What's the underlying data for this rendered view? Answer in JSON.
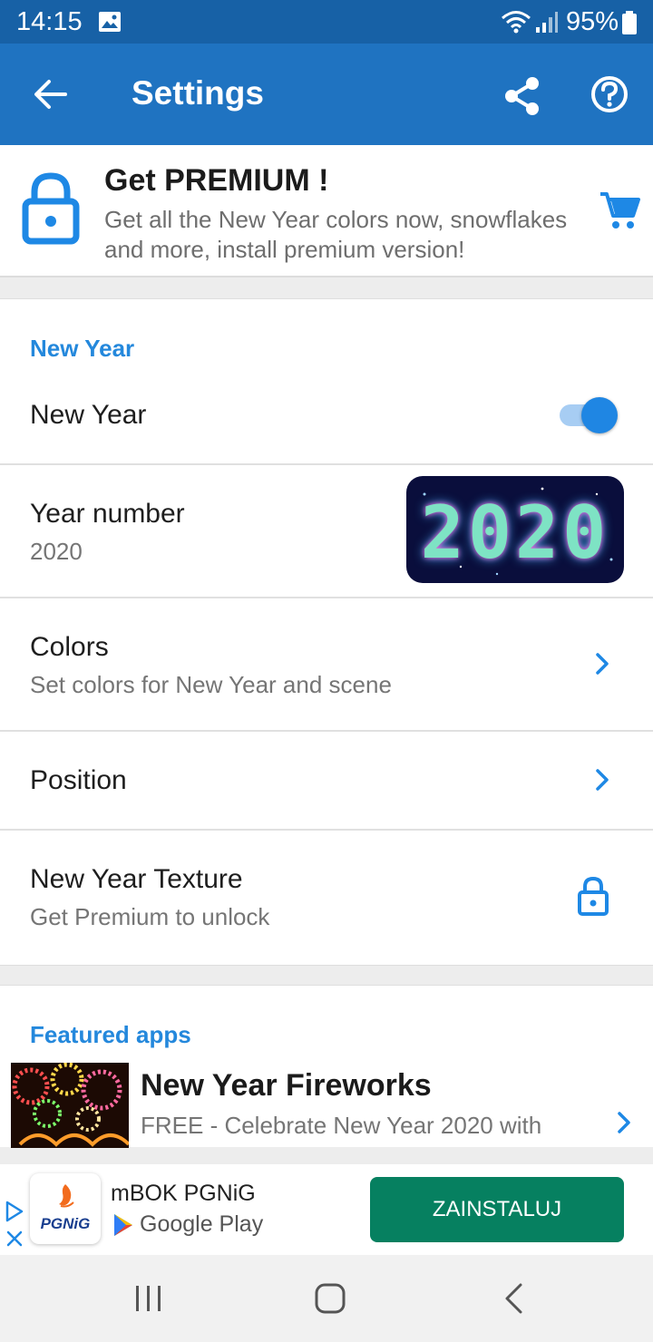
{
  "status_bar": {
    "time": "14:15",
    "battery_percent": "95%",
    "icons": [
      "gallery-icon",
      "wifi-icon",
      "signal-icon",
      "battery-icon"
    ]
  },
  "app_bar": {
    "title": "Settings",
    "icons": [
      "back-arrow-icon",
      "share-icon",
      "help-icon"
    ],
    "color": "#1f73c1"
  },
  "premium": {
    "title": "Get PREMIUM !",
    "text": "Get all the New Year colors now, snowflakes and more, install premium version!",
    "icons": [
      "lock-icon",
      "cart-icon"
    ]
  },
  "section_new_year": {
    "header": "New Year",
    "toggle_row": {
      "title": "New Year",
      "enabled": true
    },
    "year_row": {
      "title": "Year number",
      "subtitle": "2020",
      "preview_digits": "2020"
    },
    "colors_row": {
      "title": "Colors",
      "subtitle": "Set colors for New Year and scene"
    },
    "position_row": {
      "title": "Position"
    },
    "texture_row": {
      "title": "New Year Texture",
      "subtitle": "Get Premium to unlock"
    }
  },
  "section_featured": {
    "header": "Featured apps",
    "app": {
      "title": "New Year Fireworks",
      "subtitle": "FREE - Celebrate New Year 2020 with"
    }
  },
  "ad": {
    "app_name": "mBOK PGNiG",
    "logo_text": "PGNiG",
    "store": "Google Play",
    "button": "ZAINSTALUJ",
    "button_color": "#068060"
  },
  "accent_color": "#2488dc"
}
